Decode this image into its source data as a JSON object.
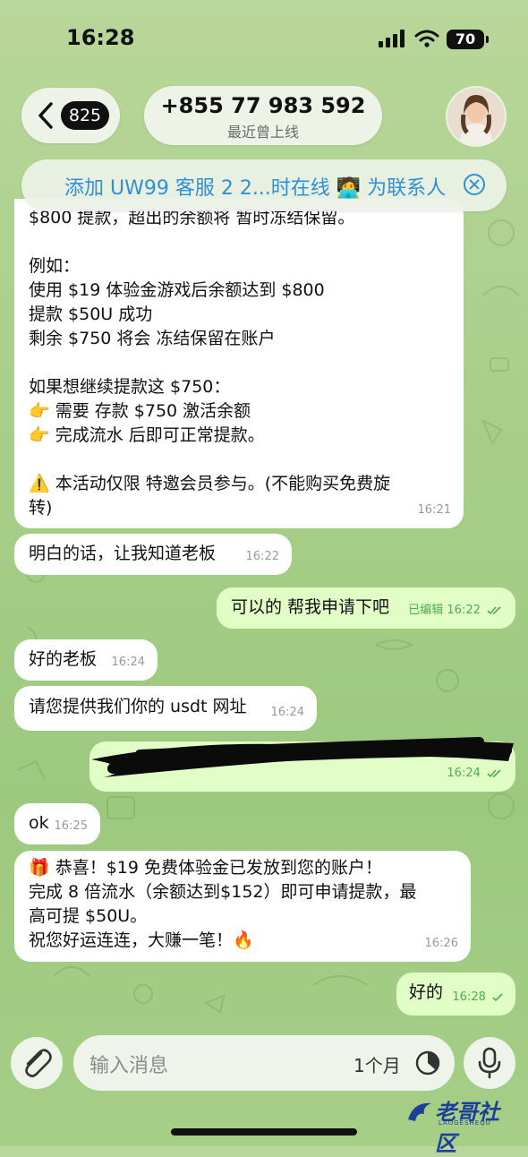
{
  "status_bar": {
    "time": "16:28",
    "battery": "70"
  },
  "header": {
    "back_count": "825",
    "phone": "+855 77 983 592",
    "subtitle": "最近曾上线"
  },
  "add_contact_banner": {
    "text": "添加 UW99 客服 2 2...时在线 🧑‍💻 为联系人"
  },
  "messages": {
    "m1": {
      "lines": [
        "$800 提款，超出的余额将 暂时冻结保留。",
        "",
        "例如：",
        "使用 $19 体验金游戏后余额达到 $800",
        "提款 $50U 成功",
        "剩余 $750 将会 冻结保留在账户",
        "",
        "如果想继续提款这 $750：",
        "👉 需要 存款 $750 激活余额",
        "👉 完成流水 后即可正常提款。",
        "",
        "⚠️ 本活动仅限 特邀会员参与。(不能购买免费旋",
        "转)"
      ],
      "time": "16:21"
    },
    "m2": {
      "text": "明白的话，让我知道老板",
      "time": "16:22"
    },
    "m3": {
      "text": "可以的 帮我申请下吧",
      "edited": "已编辑",
      "time": "16:22"
    },
    "m4": {
      "text": "好的老板",
      "time": "16:24"
    },
    "m5": {
      "text": "请您提供我们你的 usdt 网址",
      "time": "16:24"
    },
    "m6": {
      "time": "16:24"
    },
    "m7": {
      "text": "ok",
      "time": "16:25"
    },
    "m8": {
      "lines": [
        "🎁 恭喜！$19 免费体验金已发放到您的账户！",
        "完成 8 倍流水（余额达到$152）即可申请提款，最",
        "高可提 $50U。",
        "祝您好运连连，大赚一笔！🔥"
      ],
      "time": "16:26"
    },
    "m9": {
      "text": "好的",
      "time": "16:28"
    }
  },
  "input_bar": {
    "placeholder": "输入消息",
    "timer_label": "1个月"
  },
  "watermark": {
    "text": "老哥社区",
    "sub": "LAOGESHEQU"
  },
  "colors": {
    "outgoing": "#e1fec6",
    "incoming": "#ffffff",
    "accent": "#2f8fd8",
    "check": "#4fae4e"
  },
  "icons": [
    "back-chevron-icon",
    "signal-icon",
    "wifi-icon",
    "battery-icon",
    "close-circle-icon",
    "double-check-icon",
    "single-check-icon",
    "paperclip-icon",
    "timer-icon",
    "microphone-icon"
  ]
}
